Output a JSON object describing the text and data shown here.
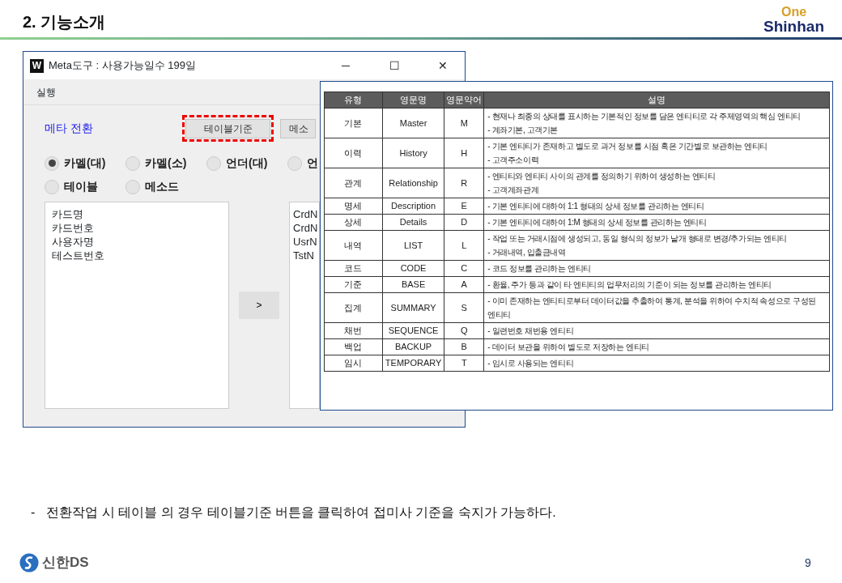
{
  "slide": {
    "title": "2. 기능소개",
    "logo_top": "One",
    "logo_bottom": "Shinhan"
  },
  "window": {
    "icon_letter": "W",
    "title": "Meta도구 : 사용가능일수 199일",
    "controls": [
      "─",
      "☐",
      "✕"
    ],
    "menu": [
      "실행"
    ],
    "section_label": "메타 전환",
    "buttons": [
      {
        "label": "테이블기준",
        "highlighted": true
      },
      {
        "label": "메소",
        "highlighted": false
      }
    ],
    "radios": [
      {
        "label": "카멜(대)",
        "selected": true
      },
      {
        "label": "카멜(소)",
        "selected": false
      },
      {
        "label": "언더(대)",
        "selected": false
      },
      {
        "label": "언",
        "selected": false
      },
      {
        "label": "테이블",
        "selected": false
      },
      {
        "label": "메소드",
        "selected": false
      }
    ],
    "source_list": [
      "카드명",
      "카드번호",
      "사용자명",
      "테스트번호"
    ],
    "move_button": ">",
    "target_list": [
      "CrdN",
      "CrdN",
      "UsrN",
      "TstN"
    ]
  },
  "table": {
    "columns": [
      "유형",
      "영문명",
      "영문약어",
      "설명"
    ],
    "rows": [
      {
        "type": "기본",
        "english": "Master",
        "abbr": "M",
        "description": [
          "- 현재나 최종의 상태를 표시하는 기본적인 정보를 담은 엔티티로 각 주제영역의 핵심 엔티티",
          "- 계좌기본, 고객기본"
        ]
      },
      {
        "type": "이력",
        "english": "History",
        "abbr": "H",
        "description": [
          "- 기본 엔티티가 존재하고 별도로 과거 정보를 시점 혹은 기간별로 보관하는 엔티티",
          "- 고객주소이력"
        ]
      },
      {
        "type": "관계",
        "english": "Relationship",
        "abbr": "R",
        "description": [
          "-  엔티티와 엔티티 사이의 관계를 정의하기 위하여 생성하는 엔티티",
          "-  고객계좌관계"
        ]
      },
      {
        "type": "명세",
        "english": "Description",
        "abbr": "E",
        "description": [
          "- 기본 엔티티에 대하여 1:1 형태의 상세 정보를 관리하는 엔티티"
        ]
      },
      {
        "type": "상세",
        "english": "Details",
        "abbr": "D",
        "description": [
          "- 기본 엔티티에 대하여 1:M 형태의 상세 정보를 관리하는 엔티티"
        ]
      },
      {
        "type": "내역",
        "english": "LIST",
        "abbr": "L",
        "description": [
          "- 작업 또는 거래시점에 생성되고, 동일 형식의 정보가 낱개 형태로 변경/추가되는 엔티티",
          "- 거래내역, 입출금내역"
        ]
      },
      {
        "type": "코드",
        "english": "CODE",
        "abbr": "C",
        "description": [
          "- 코드 정보를 관리하는 엔티티"
        ]
      },
      {
        "type": "기준",
        "english": "BASE",
        "abbr": "A",
        "description": [
          "- 환율, 주가 등과 같이 타 엔티티의 업무처리의 기준이 되는 정보를 관리하는 엔티티"
        ]
      },
      {
        "type": "집계",
        "english": "SUMMARY",
        "abbr": "S",
        "description": [
          "- 이미 존재하는 엔티티로부터 데이터값을 추출하여 통계, 분석을 위하여 수치적 속성으로 구성된 엔티티"
        ]
      },
      {
        "type": "채번",
        "english": "SEQUENCE",
        "abbr": "Q",
        "description": [
          "- 일련번호 채번용 엔티티"
        ]
      },
      {
        "type": "백업",
        "english": "BACKUP",
        "abbr": "B",
        "description": [
          "- 데이터 보관을 위하여 별도로 저장하는 엔티티"
        ]
      },
      {
        "type": "임시",
        "english": "TEMPORARY",
        "abbr": "T",
        "description": [
          "- 임시로 사용되는 엔티티"
        ]
      }
    ]
  },
  "note": {
    "bullet": "-",
    "text": "전환작업 시 테이블 의 경우 테이블기준 버튼을 클릭하여 접미사 기준을 숙지가 가능하다."
  },
  "footer": {
    "brand": "신한DS",
    "page": "9"
  }
}
